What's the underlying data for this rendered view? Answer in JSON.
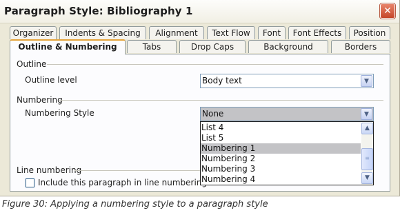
{
  "dialog": {
    "title": "Paragraph Style: Bibliography 1"
  },
  "tabs_back": [
    "Organizer",
    "Indents & Spacing",
    "Alignment",
    "Text Flow",
    "Font",
    "Font Effects",
    "Position"
  ],
  "tabs_front": [
    "Outline & Numbering",
    "Tabs",
    "Drop Caps",
    "Background",
    "Borders"
  ],
  "outline": {
    "section_label": "Outline",
    "level_label": "Outline level",
    "level_value": "Body text"
  },
  "numbering": {
    "section_label": "Numbering",
    "style_label": "Numbering Style",
    "style_value": "None",
    "options": [
      "List 4",
      "List 5",
      "Numbering 1",
      "Numbering 2",
      "Numbering 3",
      "Numbering 4"
    ],
    "highlighted_option": "Numbering 1"
  },
  "line_numbering": {
    "section_label": "Line numbering",
    "include_label": "Include this paragraph in line numbering",
    "include_checked": false
  },
  "caption": "Figure 30: Applying a numbering style to a paragraph style"
}
